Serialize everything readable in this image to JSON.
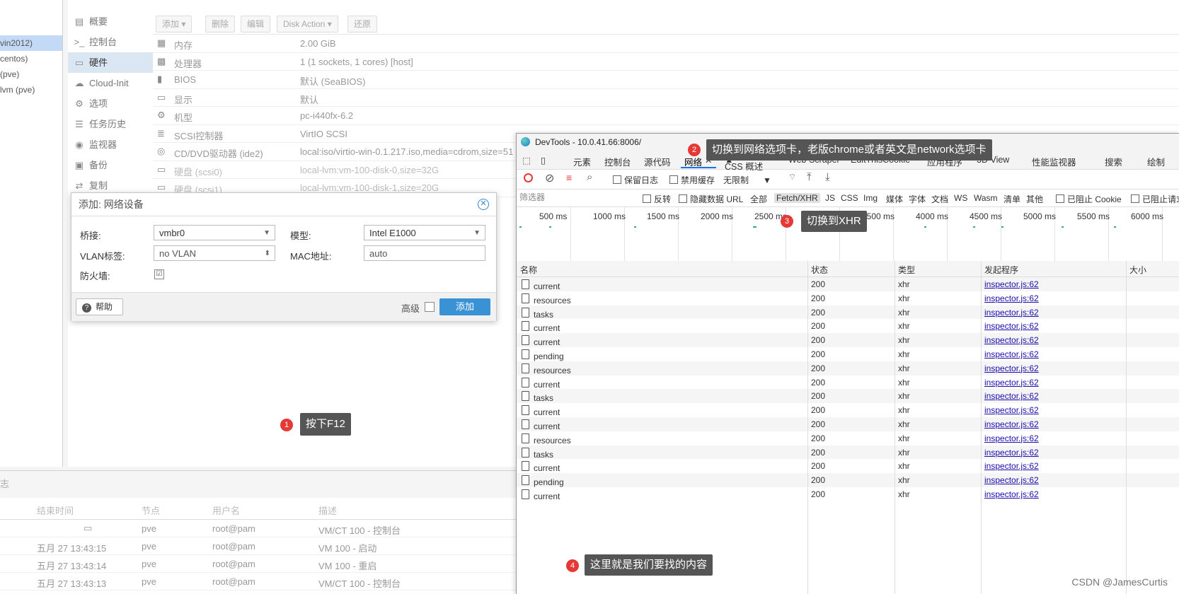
{
  "tree": [
    "vin2012)",
    "centos)",
    "(pve)",
    "lvm (pve)"
  ],
  "vm_nav": [
    {
      "icon": "book-icon",
      "glyph": "▤",
      "label": "概要"
    },
    {
      "icon": "terminal-icon",
      "glyph": ">_",
      "label": "控制台"
    },
    {
      "icon": "monitor-icon",
      "glyph": "▭",
      "label": "硬件"
    },
    {
      "icon": "cloud-icon",
      "glyph": "☁",
      "label": "Cloud-Init"
    },
    {
      "icon": "gear-icon",
      "glyph": "⚙",
      "label": "选项"
    },
    {
      "icon": "list-icon",
      "glyph": "☰",
      "label": "任务历史"
    },
    {
      "icon": "eye-icon",
      "glyph": "◉",
      "label": "监视器"
    },
    {
      "icon": "floppy-icon",
      "glyph": "▣",
      "label": "备份"
    },
    {
      "icon": "retweet-icon",
      "glyph": "⇄",
      "label": "复制"
    }
  ],
  "hw_toolbar": [
    "添加",
    "删除",
    "编辑",
    "Disk Action",
    "还原"
  ],
  "hardware": [
    {
      "icon": "memory-icon",
      "glyph": "▦",
      "key": "内存",
      "value": "2.00 GiB"
    },
    {
      "icon": "cpu-icon",
      "glyph": "▩",
      "key": "处理器",
      "value": "1 (1 sockets, 1 cores) [host]"
    },
    {
      "icon": "chip-icon",
      "glyph": "▮",
      "key": "BIOS",
      "value": "默认 (SeaBIOS)"
    },
    {
      "icon": "display-icon",
      "glyph": "▭",
      "key": "显示",
      "value": "默认"
    },
    {
      "icon": "cogs-icon",
      "glyph": "⚙",
      "key": "机型",
      "value": "pc-i440fx-6.2"
    },
    {
      "icon": "database-icon",
      "glyph": "≣",
      "key": "SCSI控制器",
      "value": "VirtIO SCSI"
    },
    {
      "icon": "cdrom-icon",
      "glyph": "◎",
      "key": "CD/DVD驱动器 (ide2)",
      "value": "local:iso/virtio-win-0.1.217.iso,media=cdrom,size=51"
    },
    {
      "icon": "hdd-icon",
      "glyph": "▭",
      "key": "硬盘 (scsi0)",
      "value": "local-lvm:vm-100-disk-0,size=32G"
    },
    {
      "icon": "hdd-icon",
      "glyph": "▭",
      "key": "硬盘 (scsi1)",
      "value": "local-lvm:vm-100-disk-1,size=20G"
    }
  ],
  "dialog": {
    "title": "添加: 网络设备",
    "bridge_label": "桥接:",
    "bridge_value": "vmbr0",
    "vlan_label": "VLAN标签:",
    "vlan_value": "no VLAN",
    "firewall_label": "防火墙:",
    "firewall_checked": "☑",
    "model_label": "模型:",
    "model_value": "Intel E1000",
    "mac_label": "MAC地址:",
    "mac_value": "auto",
    "help": "帮助",
    "advanced": "高级",
    "add": "添加"
  },
  "log": {
    "header": "志",
    "columns": [
      "结束时间",
      "节点",
      "用户名",
      "描述"
    ],
    "rows": [
      {
        "end": "",
        "node": "pve",
        "user": "root@pam",
        "desc": "VM/CT 100 - 控制台"
      },
      {
        "end": "五月 27 13:43:15",
        "node": "pve",
        "user": "root@pam",
        "desc": "VM 100 - 启动"
      },
      {
        "end": "五月 27 13:43:14",
        "node": "pve",
        "user": "root@pam",
        "desc": "VM 100 - 重启"
      },
      {
        "end": "五月 27 13:43:13",
        "node": "pve",
        "user": "root@pam",
        "desc": "VM/CT 100 - 控制台"
      }
    ]
  },
  "devtools": {
    "title": "DevTools - 10.0.41.66:8006/",
    "tabs": [
      "元素",
      "控制台",
      "源代码",
      "网络",
      "CSS 概述",
      "Web Scraper",
      "EditThisCookie",
      "应用程序",
      "3D View",
      "性能监视器",
      "搜索",
      "绘制"
    ],
    "toolbar": {
      "preserve_log": "保留日志",
      "disable_cache": "禁用缓存",
      "throttle": "无限制"
    },
    "filter": {
      "placeholder": "筛选器",
      "invert": "反转",
      "hide_data_urls": "隐藏数据 URL",
      "types": [
        "全部",
        "Fetch/XHR",
        "JS",
        "CSS",
        "Img",
        "媒体",
        "字体",
        "文档",
        "WS",
        "Wasm",
        "清单",
        "其他"
      ],
      "blocked_cookies": "已阻止 Cookie",
      "blocked_requests": "已阻止请求"
    },
    "timeline": [
      "500 ms",
      "1000 ms",
      "1500 ms",
      "2000 ms",
      "2500 ms",
      "3000 ms",
      "3500 ms",
      "4000 ms",
      "4500 ms",
      "5000 ms",
      "5500 ms",
      "6000 ms"
    ],
    "columns": {
      "name": "名称",
      "status": "状态",
      "type": "类型",
      "initiator": "发起程序",
      "size": "大小"
    },
    "requests": [
      {
        "name": "current",
        "status": "200",
        "type": "xhr",
        "initiator": "inspector.js:62"
      },
      {
        "name": "resources",
        "status": "200",
        "type": "xhr",
        "initiator": "inspector.js:62"
      },
      {
        "name": "tasks",
        "status": "200",
        "type": "xhr",
        "initiator": "inspector.js:62"
      },
      {
        "name": "current",
        "status": "200",
        "type": "xhr",
        "initiator": "inspector.js:62"
      },
      {
        "name": "current",
        "status": "200",
        "type": "xhr",
        "initiator": "inspector.js:62"
      },
      {
        "name": "pending",
        "status": "200",
        "type": "xhr",
        "initiator": "inspector.js:62"
      },
      {
        "name": "resources",
        "status": "200",
        "type": "xhr",
        "initiator": "inspector.js:62"
      },
      {
        "name": "current",
        "status": "200",
        "type": "xhr",
        "initiator": "inspector.js:62"
      },
      {
        "name": "tasks",
        "status": "200",
        "type": "xhr",
        "initiator": "inspector.js:62"
      },
      {
        "name": "current",
        "status": "200",
        "type": "xhr",
        "initiator": "inspector.js:62"
      },
      {
        "name": "current",
        "status": "200",
        "type": "xhr",
        "initiator": "inspector.js:62"
      },
      {
        "name": "resources",
        "status": "200",
        "type": "xhr",
        "initiator": "inspector.js:62"
      },
      {
        "name": "tasks",
        "status": "200",
        "type": "xhr",
        "initiator": "inspector.js:62"
      },
      {
        "name": "current",
        "status": "200",
        "type": "xhr",
        "initiator": "inspector.js:62"
      },
      {
        "name": "pending",
        "status": "200",
        "type": "xhr",
        "initiator": "inspector.js:62"
      },
      {
        "name": "current",
        "status": "200",
        "type": "xhr",
        "initiator": "inspector.js:62"
      }
    ]
  },
  "annotations": {
    "a1": {
      "num": "1",
      "text": "按下F12"
    },
    "a2": {
      "num": "2",
      "text": "切换到网络选项卡，老版chrome或者英文是network选项卡"
    },
    "a3": {
      "num": "3",
      "text": "切换到XHR"
    },
    "a4": {
      "num": "4",
      "text": "这里就是我们要找的内容"
    }
  },
  "watermark": "CSDN @JamesCurtis",
  "colors": {
    "accent": "#3892d3",
    "badge": "#e53935",
    "callout": "#555555",
    "link": "#1a0dab"
  }
}
